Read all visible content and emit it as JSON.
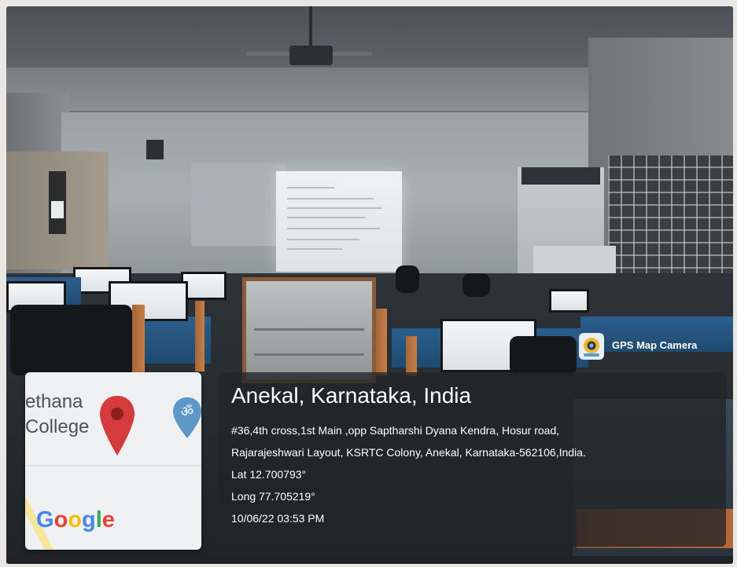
{
  "overlay": {
    "badge": {
      "label": "GPS Map Camera",
      "icon": "gps-camera-icon"
    },
    "location": {
      "title": "Anekal, Karnataka, India",
      "address_line1": "#36,4th cross,1st Main ,opp Saptharshi Dyana Kendra, Hosur road,",
      "address_line2": "Rajarajeshwari Layout, KSRTC Colony, Anekal, Karnataka-562106,India.",
      "lat": "Lat 12.700793°",
      "long": "Long 77.705219°",
      "timestamp": "10/06/22 03:53 PM"
    },
    "map": {
      "place_line1": "ethana",
      "place_line2": "College",
      "brand": "Google",
      "brand_colors": [
        "#4285F4",
        "#EA4335",
        "#FBBC05",
        "#4285F4",
        "#34A853",
        "#EA4335"
      ],
      "pin_color": "#d63b3b",
      "landmark_icon": "om-temple-icon",
      "landmark_color": "#5b97c7"
    }
  }
}
